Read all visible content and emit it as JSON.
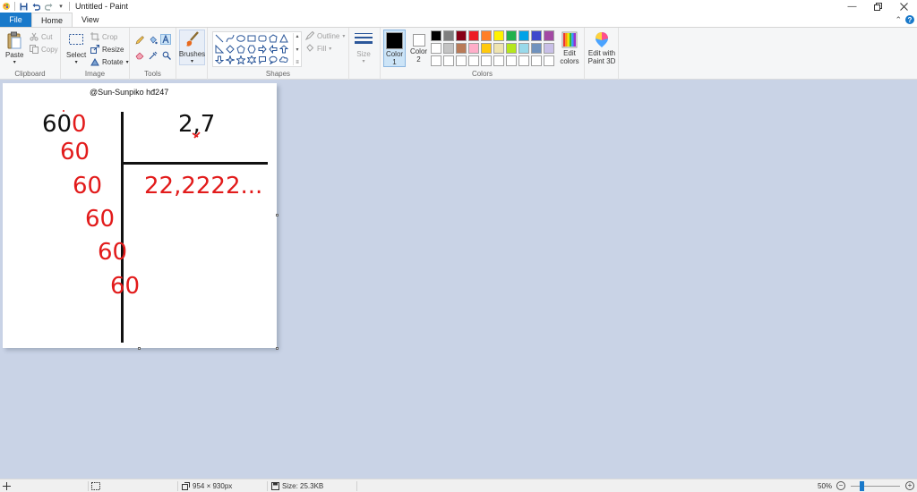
{
  "window": {
    "title": "Untitled - Paint"
  },
  "tabs": [
    {
      "label": "File"
    },
    {
      "label": "Home"
    },
    {
      "label": "View"
    }
  ],
  "ribbon": {
    "clipboard": {
      "label": "Clipboard",
      "paste": "Paste",
      "cut": "Cut",
      "copy": "Copy"
    },
    "image": {
      "label": "Image",
      "select": "Select",
      "crop": "Crop",
      "resize": "Resize",
      "rotate": "Rotate"
    },
    "tools": {
      "label": "Tools"
    },
    "brushes": {
      "label": "Brushes"
    },
    "shapes": {
      "label": "Shapes",
      "outline": "Outline",
      "fill": "Fill"
    },
    "size": {
      "label": "Size"
    },
    "colors": {
      "label": "Colors",
      "color1": "Color 1",
      "color2": "Color 2",
      "edit_colors": "Edit colors",
      "edit_paint3d": "Edit with Paint 3D",
      "color1_value": "#000000",
      "color2_value": "#ffffff",
      "palette": [
        "#000000",
        "#7f7f7f",
        "#880015",
        "#ed1c24",
        "#ff7f27",
        "#fff200",
        "#22b14c",
        "#00a2e8",
        "#3f48cc",
        "#a349a4",
        "#ffffff",
        "#c3c3c3",
        "#b97a57",
        "#ffaec9",
        "#ffc90e",
        "#efe4b0",
        "#b5e61d",
        "#99d9ea",
        "#7092be",
        "#c8bfe7",
        "#ffffff",
        "#ffffff",
        "#ffffff",
        "#ffffff",
        "#ffffff",
        "#ffffff",
        "#ffffff",
        "#ffffff",
        "#ffffff",
        "#ffffff"
      ]
    }
  },
  "canvas": {
    "watermark": "@Sun-Sunpiko  hđ247",
    "dividend_black": "60",
    "dividend_red": "0",
    "divisor": "2,7",
    "quotient": "22,2222...",
    "remainders": [
      "60",
      "60",
      "60",
      "60",
      "60"
    ]
  },
  "status": {
    "dimensions": "954 × 930px",
    "size": "Size: 25.3KB",
    "zoom": "50%"
  }
}
